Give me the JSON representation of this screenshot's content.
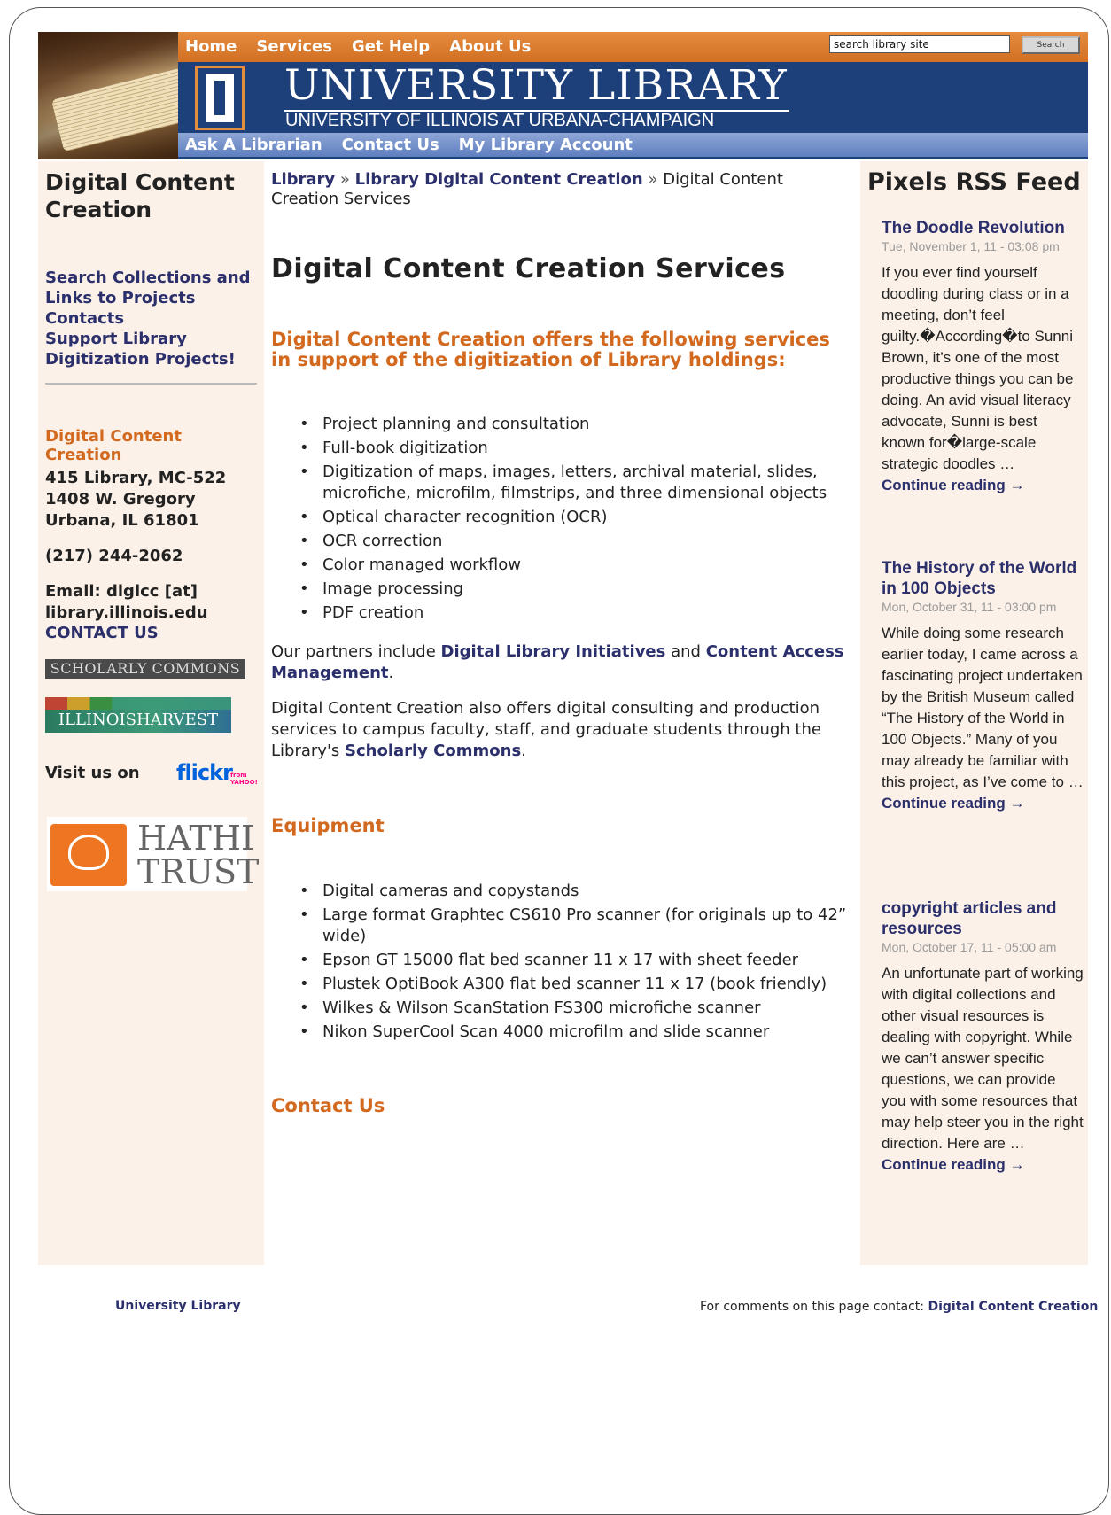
{
  "header": {
    "top_nav": [
      "Home",
      "Services",
      "Get Help",
      "About Us"
    ],
    "search_placeholder": "search library site",
    "search_button": "Search",
    "brand_title": "UNIVERSITY LIBRARY",
    "brand_subtitle": "UNIVERSITY OF ILLINOIS AT URBANA-CHAMPAIGN",
    "sub_nav": [
      "Ask A Librarian",
      "Contact Us",
      "My Library Account"
    ]
  },
  "sidebar": {
    "title": "Digital Content Creation",
    "links": [
      "Search Collections and Links to Projects",
      "Contacts",
      "Support Library Digitization Projects!"
    ],
    "unit_name": "Digital Content Creation",
    "address": [
      "415 Library, MC-522",
      "1408 W. Gregory",
      "Urbana, IL 61801"
    ],
    "phone": "(217) 244-2062",
    "email_label": "Email: digicc [at]",
    "email_domain": "library.illinois.edu",
    "contact_link": "CONTACT US",
    "scholarly_commons": "SCHOLARLY COMMONS",
    "illinois_harvest": "ILLINOISHARVEST",
    "visit_label": "Visit us on",
    "flickr": "flickr",
    "flickr_sub": "from YAHOO!",
    "hathi_line1": "HATHI",
    "hathi_line2": "TRUST"
  },
  "main": {
    "breadcrumb": {
      "crumb1": "Library",
      "sep": "»",
      "crumb2": "Library Digital Content Creation",
      "current": "Digital Content Creation Services"
    },
    "title": "Digital Content Creation Services",
    "intro_heading": "Digital Content Creation offers the following services in support of the digitization of Library holdings:",
    "services": [
      "Project planning and consultation",
      "Full-book digitization",
      "Digitization of maps, images, letters, archival material, slides, microfiche, microfilm, filmstrips, and three dimensional objects",
      "Optical character recognition (OCR)",
      "OCR correction",
      "Color managed workflow",
      "Image processing",
      "PDF creation"
    ],
    "partners_prefix": "Our partners include",
    "partner1": "Digital Library Initiatives",
    "partners_and": "and",
    "partner2": "Content Access Management",
    "partners_end": ".",
    "consult_text": "Digital Content Creation also offers digital consulting and production services to campus faculty, staff, and graduate students through the Library's",
    "consult_link": "Scholarly Commons",
    "consult_end": ".",
    "equipment_heading": "Equipment",
    "equipment": [
      "Digital cameras and copystands",
      "Large format Graphtec CS610 Pro scanner (for originals up to 42” wide)",
      "Epson GT 15000 flat bed scanner 11 x 17 with sheet feeder",
      "Plustek OptiBook A300 flat bed scanner 11 x 17 (book friendly)",
      "Wilkes & Wilson ScanStation FS300 microfiche scanner",
      "Nikon SuperCool Scan 4000 microfilm and slide scanner"
    ],
    "contact_heading": "Contact Us"
  },
  "rss": {
    "title": "Pixels RSS Feed",
    "posts": [
      {
        "title": "The Doodle Revolution",
        "date": "Tue, November 1, 11 - 03:08 pm",
        "body": "If you ever find yourself doodling during class or in a meeting, don’t feel guilty.�According�to Sunni Brown, it’s one of the most productive things you can be doing. An avid visual literacy advocate, Sunni is best known for�large-scale strategic doodles …",
        "more": "Continue reading →"
      },
      {
        "title": "The History of the World in 100 Objects",
        "date": "Mon, October 31, 11 - 03:00 pm",
        "body": "While doing some research earlier today, I came across a fascinating project undertaken by the British Museum called “The History of the World in 100 Objects.” Many of you may already be familiar with this project, as I’ve come to …",
        "more": "Continue reading →"
      },
      {
        "title": "copyright articles and resources",
        "date": "Mon, October 17, 11 - 05:00 am",
        "body": "An unfortunate part of working with digital collections and other visual resources is dealing with copyright. While we can’t answer specific questions, we can provide you with some resources that may help steer you in the right direction. Here are …",
        "more": "Continue reading →"
      }
    ]
  },
  "footer": {
    "left_link": "University Library",
    "right_text": "For comments on this page contact:",
    "right_link": "Digital Content Creation"
  },
  "colors": {
    "orange": "#d2691e",
    "navy": "#1d3f7a",
    "link": "#2b2f6b",
    "sidebar_bg": "#fbf1e8"
  }
}
